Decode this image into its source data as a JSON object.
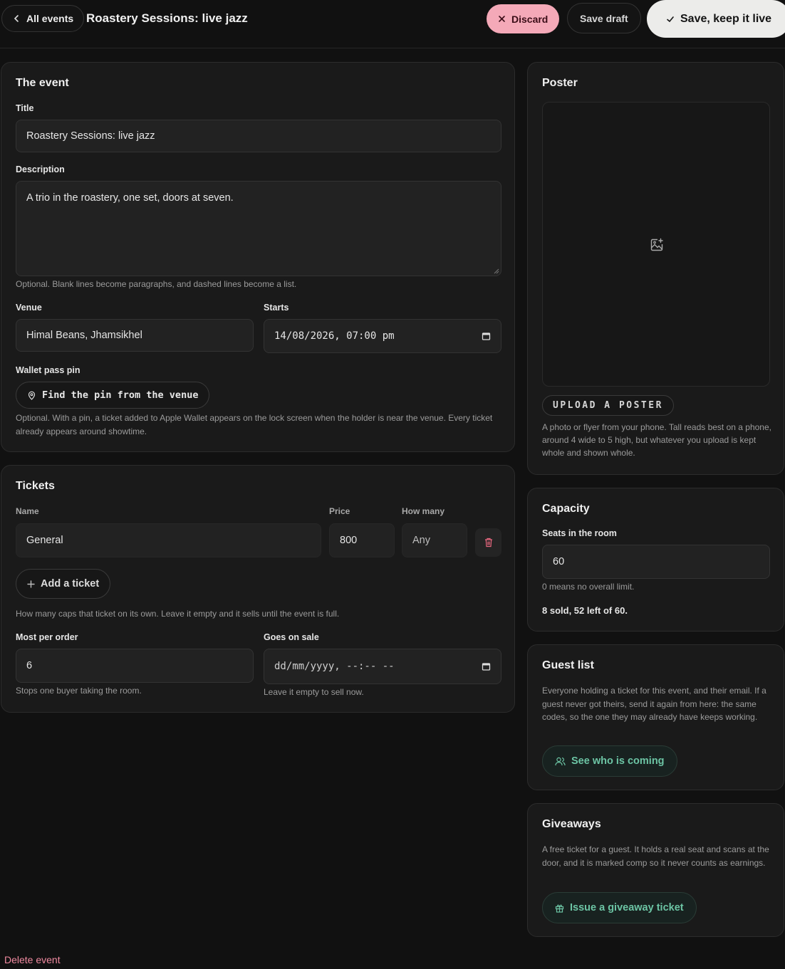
{
  "header": {
    "back_label": "All events",
    "title": "Roastery Sessions: live jazz",
    "discard_label": "Discard",
    "draft_label": "Save draft",
    "live_label": "Save, keep it live"
  },
  "event": {
    "heading": "The event",
    "title_label": "Title",
    "title_value": "Roastery Sessions: live jazz",
    "description_label": "Description",
    "description_value": "A trio in the roastery, one set, doors at seven.",
    "description_help": "Optional. Blank lines become paragraphs, and dashed lines become a list.",
    "venue_label": "Venue",
    "venue_value": "Himal Beans, Jhamsikhel",
    "starts_label": "Starts",
    "starts_value": "14/08/2026, 07:00 pm",
    "pin_label": "Wallet pass pin",
    "pin_button": "Find the pin from the venue",
    "pin_help": "Optional. With a pin, a ticket added to Apple Wallet appears on the lock screen when the holder is near the venue. Every ticket already appears around showtime."
  },
  "tickets": {
    "heading": "Tickets",
    "col_name": "Name",
    "col_price": "Price",
    "col_qty": "How many",
    "rows": [
      {
        "name": "General",
        "price": "800",
        "qty": "Any"
      }
    ],
    "add_label": "Add a ticket",
    "qty_help": "How many caps that ticket on its own. Leave it empty and it sells until the event is full.",
    "max_label": "Most per order",
    "max_value": "6",
    "max_help": "Stops one buyer taking the room.",
    "sale_label": "Goes on sale",
    "sale_placeholder": "dd/mm/yyyy, --:-- --",
    "sale_help": "Leave it empty to sell now."
  },
  "poster": {
    "heading": "Poster",
    "upload_label": "UPLOAD A POSTER",
    "help": "A photo or flyer from your phone. Tall reads best on a phone, around 4 wide to 5 high, but whatever you upload is kept whole and shown whole."
  },
  "capacity": {
    "heading": "Capacity",
    "seats_label": "Seats in the room",
    "seats_value": "60",
    "seats_help": "0 means no overall limit.",
    "summary": "8 sold, 52 left of 60."
  },
  "guests": {
    "heading": "Guest list",
    "help": "Everyone holding a ticket for this event, and their email. If a guest never got theirs, send it again from here: the same codes, so the one they may already have keeps working.",
    "button": "See who is coming"
  },
  "giveaways": {
    "heading": "Giveaways",
    "help": "A free ticket for a guest. It holds a real seat and scans at the door, and it is marked comp so it never counts as earnings.",
    "button": "Issue a giveaway ticket"
  },
  "footer": {
    "delete_label": "Delete event"
  },
  "colors": {
    "background": "#111111",
    "card": "#1a1a1a",
    "discard": "#f4a9b8",
    "accent_green": "#6cc4a4",
    "danger": "#f08aa0"
  }
}
